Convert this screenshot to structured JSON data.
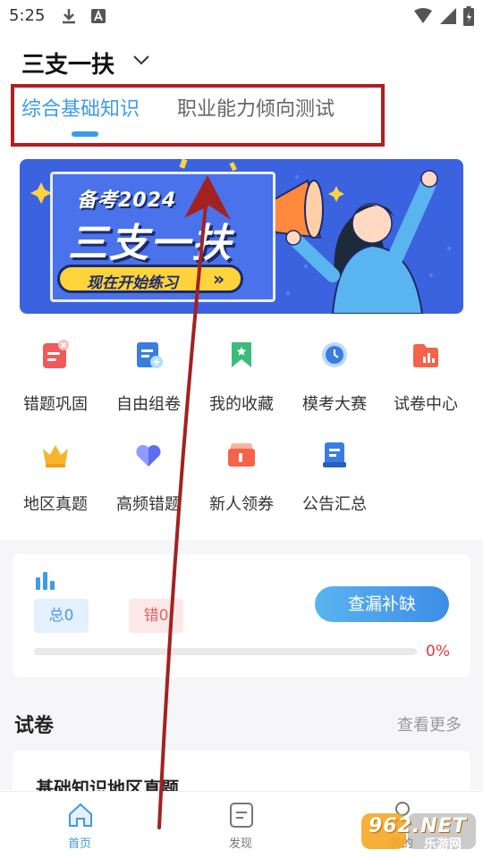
{
  "status_bar": {
    "time": "5:25"
  },
  "header": {
    "title": "三支一扶"
  },
  "tabs": [
    {
      "label": "综合基础知识",
      "active": true
    },
    {
      "label": "职业能力倾向测试",
      "active": false
    }
  ],
  "banner": {
    "line1": "备考2024",
    "line2": "三支一扶",
    "cta": "现在开始练习"
  },
  "grid": [
    {
      "label": "错题巩固",
      "icon": "wrong-questions-icon"
    },
    {
      "label": "自由组卷",
      "icon": "free-paper-icon"
    },
    {
      "label": "我的收藏",
      "icon": "favorites-icon"
    },
    {
      "label": "模考大赛",
      "icon": "mock-exam-icon"
    },
    {
      "label": "试卷中心",
      "icon": "paper-center-icon"
    },
    {
      "label": "地区真题",
      "icon": "crown-icon"
    },
    {
      "label": "高频错题",
      "icon": "heart-icon"
    },
    {
      "label": "新人领券",
      "icon": "coupon-icon"
    },
    {
      "label": "公告汇总",
      "icon": "notice-icon"
    }
  ],
  "stats": {
    "total_label": "总0",
    "wrong_label": "错0",
    "fill_button": "查漏补缺",
    "progress_percent": 0,
    "progress_label": "0%"
  },
  "papers": {
    "title": "试卷",
    "more": "查看更多",
    "first_item": "基础知识地区真题"
  },
  "bottom_nav": [
    {
      "label": "首页",
      "active": true
    },
    {
      "label": "发现",
      "active": false
    },
    {
      "label": "我的",
      "active": false
    }
  ],
  "watermark": {
    "text": "962.NET",
    "subtext": "乐游网"
  },
  "colors": {
    "accent": "#3d9be9",
    "annotation": "#b02020",
    "banner_bg": "#3b63e0"
  }
}
